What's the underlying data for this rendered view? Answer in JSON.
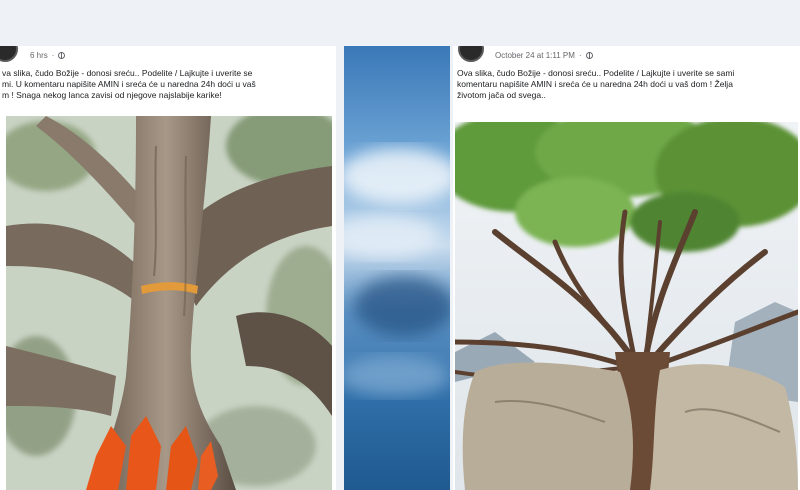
{
  "left_post": {
    "time": "6 hrs",
    "caption_lines": [
      "va slika, čudo Božije - donosi sreću.. Podelite / Lajkujte i uverite se",
      "mi. U komentaru napišite AMIN i sreća će u naredna 24h doći u vaš",
      "m ! Snaga nekog lanca zavisi od njegove najslabije karike!"
    ]
  },
  "right_post": {
    "time": "October 24 at 1:11 PM",
    "caption_lines": [
      "Ova slika, čudo Božije - donosi sreću.. Podelite / Lajkujte i uverite se sami",
      "komentaru napišite AMIN i sreća će u naredna 24h doći u vaš dom ! Želja",
      "životom jača od svega.."
    ]
  },
  "icons": {
    "privacy": "globe-icon"
  },
  "colors": {
    "page_background": "#eef1f6",
    "caption_text": "#1c1e21",
    "meta_text": "#65676b",
    "orange_marking": "#e8561a"
  }
}
